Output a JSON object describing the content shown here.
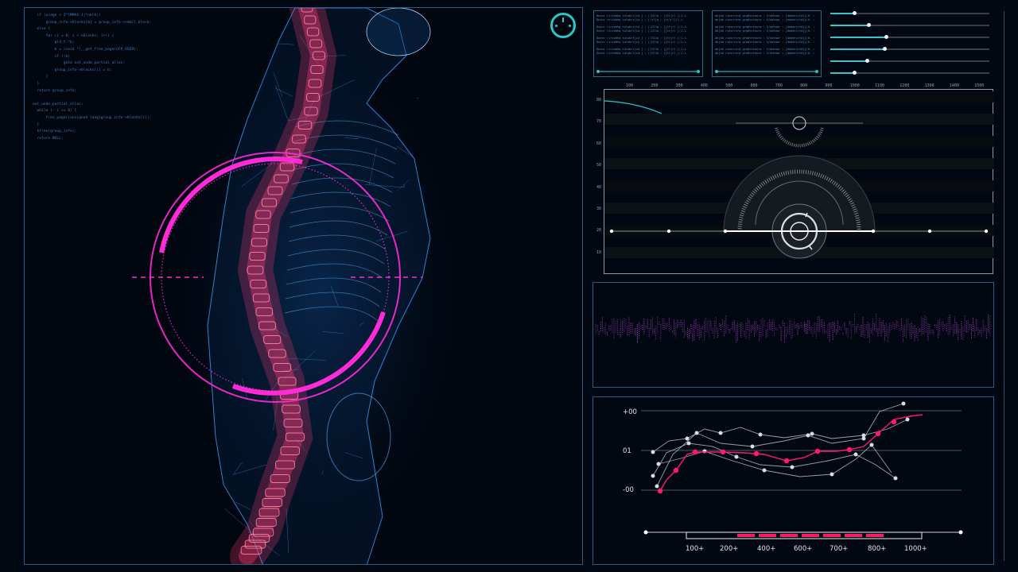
{
  "code_lines": [
    "  if (usage < 2^(MMAX-1)*nblk))",
    "      group_info->blocks[0] = group_info->small_block;",
    "  else {",
    "      for (i = 0; i < nblocks; i++) {",
    "          gid_t *b;",
    "          b = (void *)__get_free_page(GFP_USER);",
    "          if (!b)",
    "              goto out_undo_partial_alloc;",
    "          group_info->blocks[i] = b;",
    "      }",
    "  }",
    "  return group_info;",
    "",
    "out_undo_partial_alloc:",
    "  while (--i >= 0) {",
    "      free_page((unsigned long)group_info->blocks[i]);",
    "  }",
    "  kfree(group_info);",
    "  return NULL;"
  ],
  "log_box_1": [
    "Dosnr ririddhq tulobrr[id ] ; [(CEJq ; [[tt]rl [(1-i-",
    "Dosnr rnriddhq tulobrr[id ] ; [(tl]q ; [tt]rl[(1-i-",
    "Dosnr ririddhq tulobrr[id ] ; [(CEJq ; [[tt]rl [(1-i-",
    "Dosnr ririddhq tulobrr[id ] ; [(CEJq ; [[tt]rl [(1-i-",
    "Dosnr ririddhq tulobrr[id ] ; [(CEJq ; [[tt]rl [(1-i-",
    "Dosnr ririddhq tulobrr[id ] ; [(CEJq ; [[tt]rl [(1-i-",
    "Dosnr ririddhq tulobrr[id ] ; [(CEJq ; [[tt]rl [(1-i-",
    "Dosnr ririddhq tulobrr[id ] ; [(CEJq ; [[tt]rl [(1-i-"
  ],
  "log_box_2": [
    "ab[dd riasrrnrq grq0rntanra : S/ddtaar : [ddddrirtd}}(0-  :",
    "ab[dd riasrrnrq grq0rntanra : S/ddtaar : [ddddrirtd}}(0-  :",
    "ab[dd riasrrnrq grq0rntanra : S/ddtaar : [ddddrirtd}}(0-  :",
    "ab[dd riasrrnrq grq0rntanra : S/ddtaar : [ddddrirtd}}(0-  :",
    "ab[dd riasrrnrq grq0rntanra : S/ddtaar : [ddddrirtd}}(0-  :",
    "ab[dd riasrrnrq grq0rntanra : S/ddtaar : [ddddrirtd}}(0-  :",
    "ab[dd riasrrnrq grq0rntanra : S/ddtaar : [ddddrirtd}}(0-  :",
    "ab[dd riasrrnrq grq0rntanra : S/ddtaar : [ddddrirtd}}(0-  :"
  ],
  "sliders": [
    0.15,
    0.24,
    0.35,
    0.34,
    0.23,
    0.15
  ],
  "radar": {
    "x_ticks": [
      "100",
      "200",
      "300",
      "400",
      "500",
      "600",
      "700",
      "800",
      "900",
      "1000",
      "1100",
      "1200",
      "1300",
      "1400",
      "1500"
    ],
    "y_ticks": [
      "80",
      "70",
      "60",
      "50",
      "40",
      "30",
      "20",
      "10"
    ]
  },
  "graph": {
    "y_labels": [
      "+00",
      "01",
      "-00"
    ],
    "x_labels": [
      "100+",
      "200+",
      "400+",
      "600+",
      "700+",
      "800+",
      "1000+"
    ]
  },
  "colors": {
    "accent": "#27c7c8",
    "spine": "#ff3b78",
    "skeleton": "#3aa0ff",
    "ring": "#ff2ad8",
    "series_highlight": "#ff1a6a",
    "series_gray": "#bfc6cc"
  }
}
